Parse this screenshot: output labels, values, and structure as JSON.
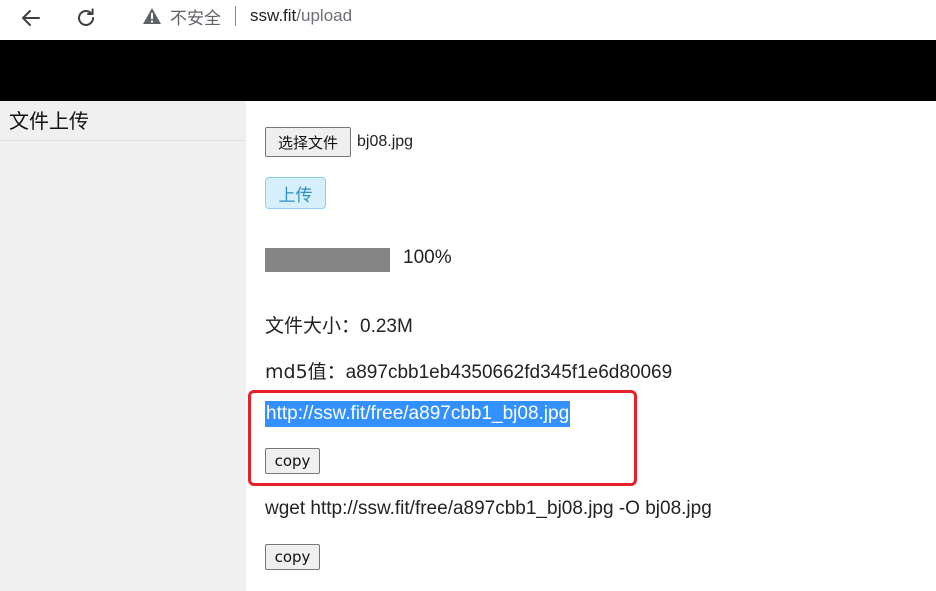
{
  "browser": {
    "security_label": "不安全",
    "url_host": "ssw.fit",
    "url_path": "/upload"
  },
  "sidebar": {
    "items": [
      {
        "label": "文件上传"
      }
    ]
  },
  "upload": {
    "choose_file_label": "选择文件",
    "file_name": "bj08.jpg",
    "upload_button_label": "上传",
    "progress_value": 1.0,
    "progress_text": "100%",
    "file_size_label": "文件大小：",
    "file_size_value": "0.23M",
    "md5_label": "md5值：",
    "md5_value": "a897cbb1eb4350662fd345f1e6d80069",
    "link_url": "http://ssw.fit/free/a897cbb1_bj08.jpg",
    "copy_link_label": "copy",
    "wget_command": "wget http://ssw.fit/free/a897cbb1_bj08.jpg -O bj08.jpg",
    "copy_wget_label": "copy"
  },
  "colors": {
    "banner": "#000000",
    "sidebar_bg": "#f0f0f0",
    "upload_button_bg": "#d7effa",
    "progress_fill": "#858585",
    "selection_highlight": "#3390ff",
    "annotation_frame": "#e8202a"
  }
}
